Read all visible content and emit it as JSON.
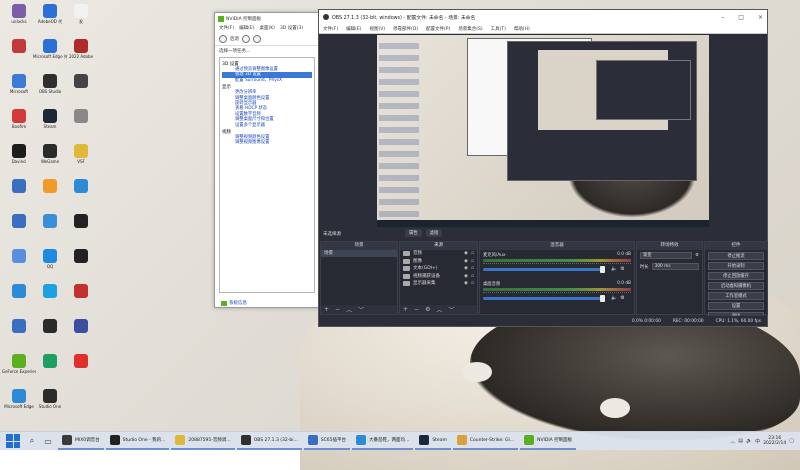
{
  "desktop": {
    "icons": [
      {
        "label": "unlocks",
        "color": "#7b5ea7"
      },
      {
        "label": "AdobeOD 代",
        "color": "#2c6fd6"
      },
      {
        "label": "发",
        "color": "#f2f2f2"
      },
      {
        "label": "",
        "color": "#c23a3a"
      },
      {
        "label": "Microsoft Edge 外站",
        "color": "#2c6fd6"
      },
      {
        "label": "2022 Adobe",
        "color": "#b12a2a"
      },
      {
        "label": "Microsoft",
        "color": "#3b7bd6"
      },
      {
        "label": "OBS Studio",
        "color": "#2f2f2f"
      },
      {
        "label": "",
        "color": "#444"
      },
      {
        "label": "Boofire",
        "color": "#d43a3a"
      },
      {
        "label": "Steam",
        "color": "#1b2838"
      },
      {
        "label": "",
        "color": "#888"
      },
      {
        "label": "Davinci",
        "color": "#1d1d1d"
      },
      {
        "label": "WeGame",
        "color": "#2b2b2b"
      },
      {
        "label": "VSF",
        "color": "#e0b83a"
      },
      {
        "label": "",
        "color": "#3a6fc0"
      },
      {
        "label": "",
        "color": "#f09a2a"
      },
      {
        "label": "",
        "color": "#2c8ad6"
      },
      {
        "label": "",
        "color": "#3a6fc0"
      },
      {
        "label": "",
        "color": "#3a8fd6"
      },
      {
        "label": "",
        "color": "#222"
      },
      {
        "label": "",
        "color": "#5a8fe0"
      },
      {
        "label": "QQ",
        "color": "#1f8be0"
      },
      {
        "label": "",
        "color": "#222"
      },
      {
        "label": "",
        "color": "#2c8ad6"
      },
      {
        "label": "",
        "color": "#1fa0e0"
      },
      {
        "label": "",
        "color": "#c23030"
      },
      {
        "label": "",
        "color": "#3a6fc0"
      },
      {
        "label": "",
        "color": "#2b2b2b"
      },
      {
        "label": "",
        "color": "#3a4fa0"
      },
      {
        "label": "GeForce Experience",
        "color": "#5ab020"
      },
      {
        "label": "",
        "color": "#20a060"
      },
      {
        "label": "",
        "color": "#e0302a"
      },
      {
        "label": "Microsoft Edge",
        "color": "#2c8ad6"
      },
      {
        "label": "Studio One",
        "color": "#2b2b2b"
      }
    ]
  },
  "nvidia": {
    "title": "NVIDIA 控制面板",
    "menu": [
      "文件(F)",
      "编辑(E)",
      "桌面(K)",
      "3D 设置(3)"
    ],
    "back": "后退",
    "task_label": "选择一项任务...",
    "tree": [
      {
        "cat": "3D 设置",
        "items": [
          "通过预览调整图像设置",
          "管理 3D 设置",
          "配置 Surround、PhysX"
        ],
        "selected": 1
      },
      {
        "cat": "显示",
        "items": [
          "更改分辨率",
          "调整桌面颜色设置",
          "旋转显示器",
          "查看 HDCP 状态",
          "设置数字音频",
          "调整桌面尺寸和位置",
          "设置多个显示器"
        ]
      },
      {
        "cat": "视频",
        "items": [
          "调整视频颜色设置",
          "调整视频图像设置"
        ]
      }
    ],
    "footer": "系统信息"
  },
  "obs": {
    "title": "OBS 27.1.3 (32-bit, windows) - 配置文件: 未命名 - 场景: 未命名",
    "menu": [
      "文件(F)",
      "编辑(E)",
      "视图(V)",
      "停靠部件(D)",
      "配置文件(P)",
      "场景集合(S)",
      "工具(T)",
      "帮助(H)"
    ],
    "preview_label": "未选择源",
    "props": [
      "属性",
      "滤镜"
    ],
    "scenes": {
      "title": "场景",
      "items": [
        "场景"
      ]
    },
    "sources": {
      "title": "来源",
      "items": [
        "音频",
        "图像",
        "文本(GDI+)",
        "视频捕获设备",
        "显示器采集"
      ]
    },
    "mixer": {
      "title": "混音器",
      "tracks": [
        {
          "name": "麦克风/Aux",
          "db": "0.0 dB"
        },
        {
          "name": "桌面音频",
          "db": "0.0 dB"
        }
      ]
    },
    "transitions": {
      "title": "转场特效",
      "type": "渐变",
      "duration_label": "时长",
      "duration": "300 ms"
    },
    "controls": {
      "title": "控件",
      "buttons": [
        "停止推流",
        "开始录制",
        "停止回放缓存",
        "启动虚拟摄像机",
        "工作室模式",
        "设置",
        "退出"
      ]
    },
    "status": [
      "0.0% 0:00:00",
      "REC: 00:00:00",
      "CPU: 1.1%, 60.00 fps"
    ]
  },
  "taskbar": {
    "search_icon": "search-icon",
    "apps": [
      {
        "label": "MIX0调音台",
        "color": "#3a3a3a"
      },
      {
        "label": "Studio One - 我的...",
        "color": "#222"
      },
      {
        "label": "20887595-音频调...",
        "color": "#e0b83a"
      },
      {
        "label": "OBS 27.1.3 (32-bi...",
        "color": "#2f2f2f"
      },
      {
        "label": "SC65插平台",
        "color": "#3a6fc0"
      },
      {
        "label": "大番茄鞋，两面均...",
        "color": "#2c8ad6"
      },
      {
        "label": "Steam",
        "color": "#1b2838"
      },
      {
        "label": "Counter-Strike: Gl...",
        "color": "#d9a13a"
      },
      {
        "label": "NVIDIA 控制面板",
        "color": "#5ab020"
      }
    ],
    "time": "23:16",
    "date": "2022/2/14"
  }
}
